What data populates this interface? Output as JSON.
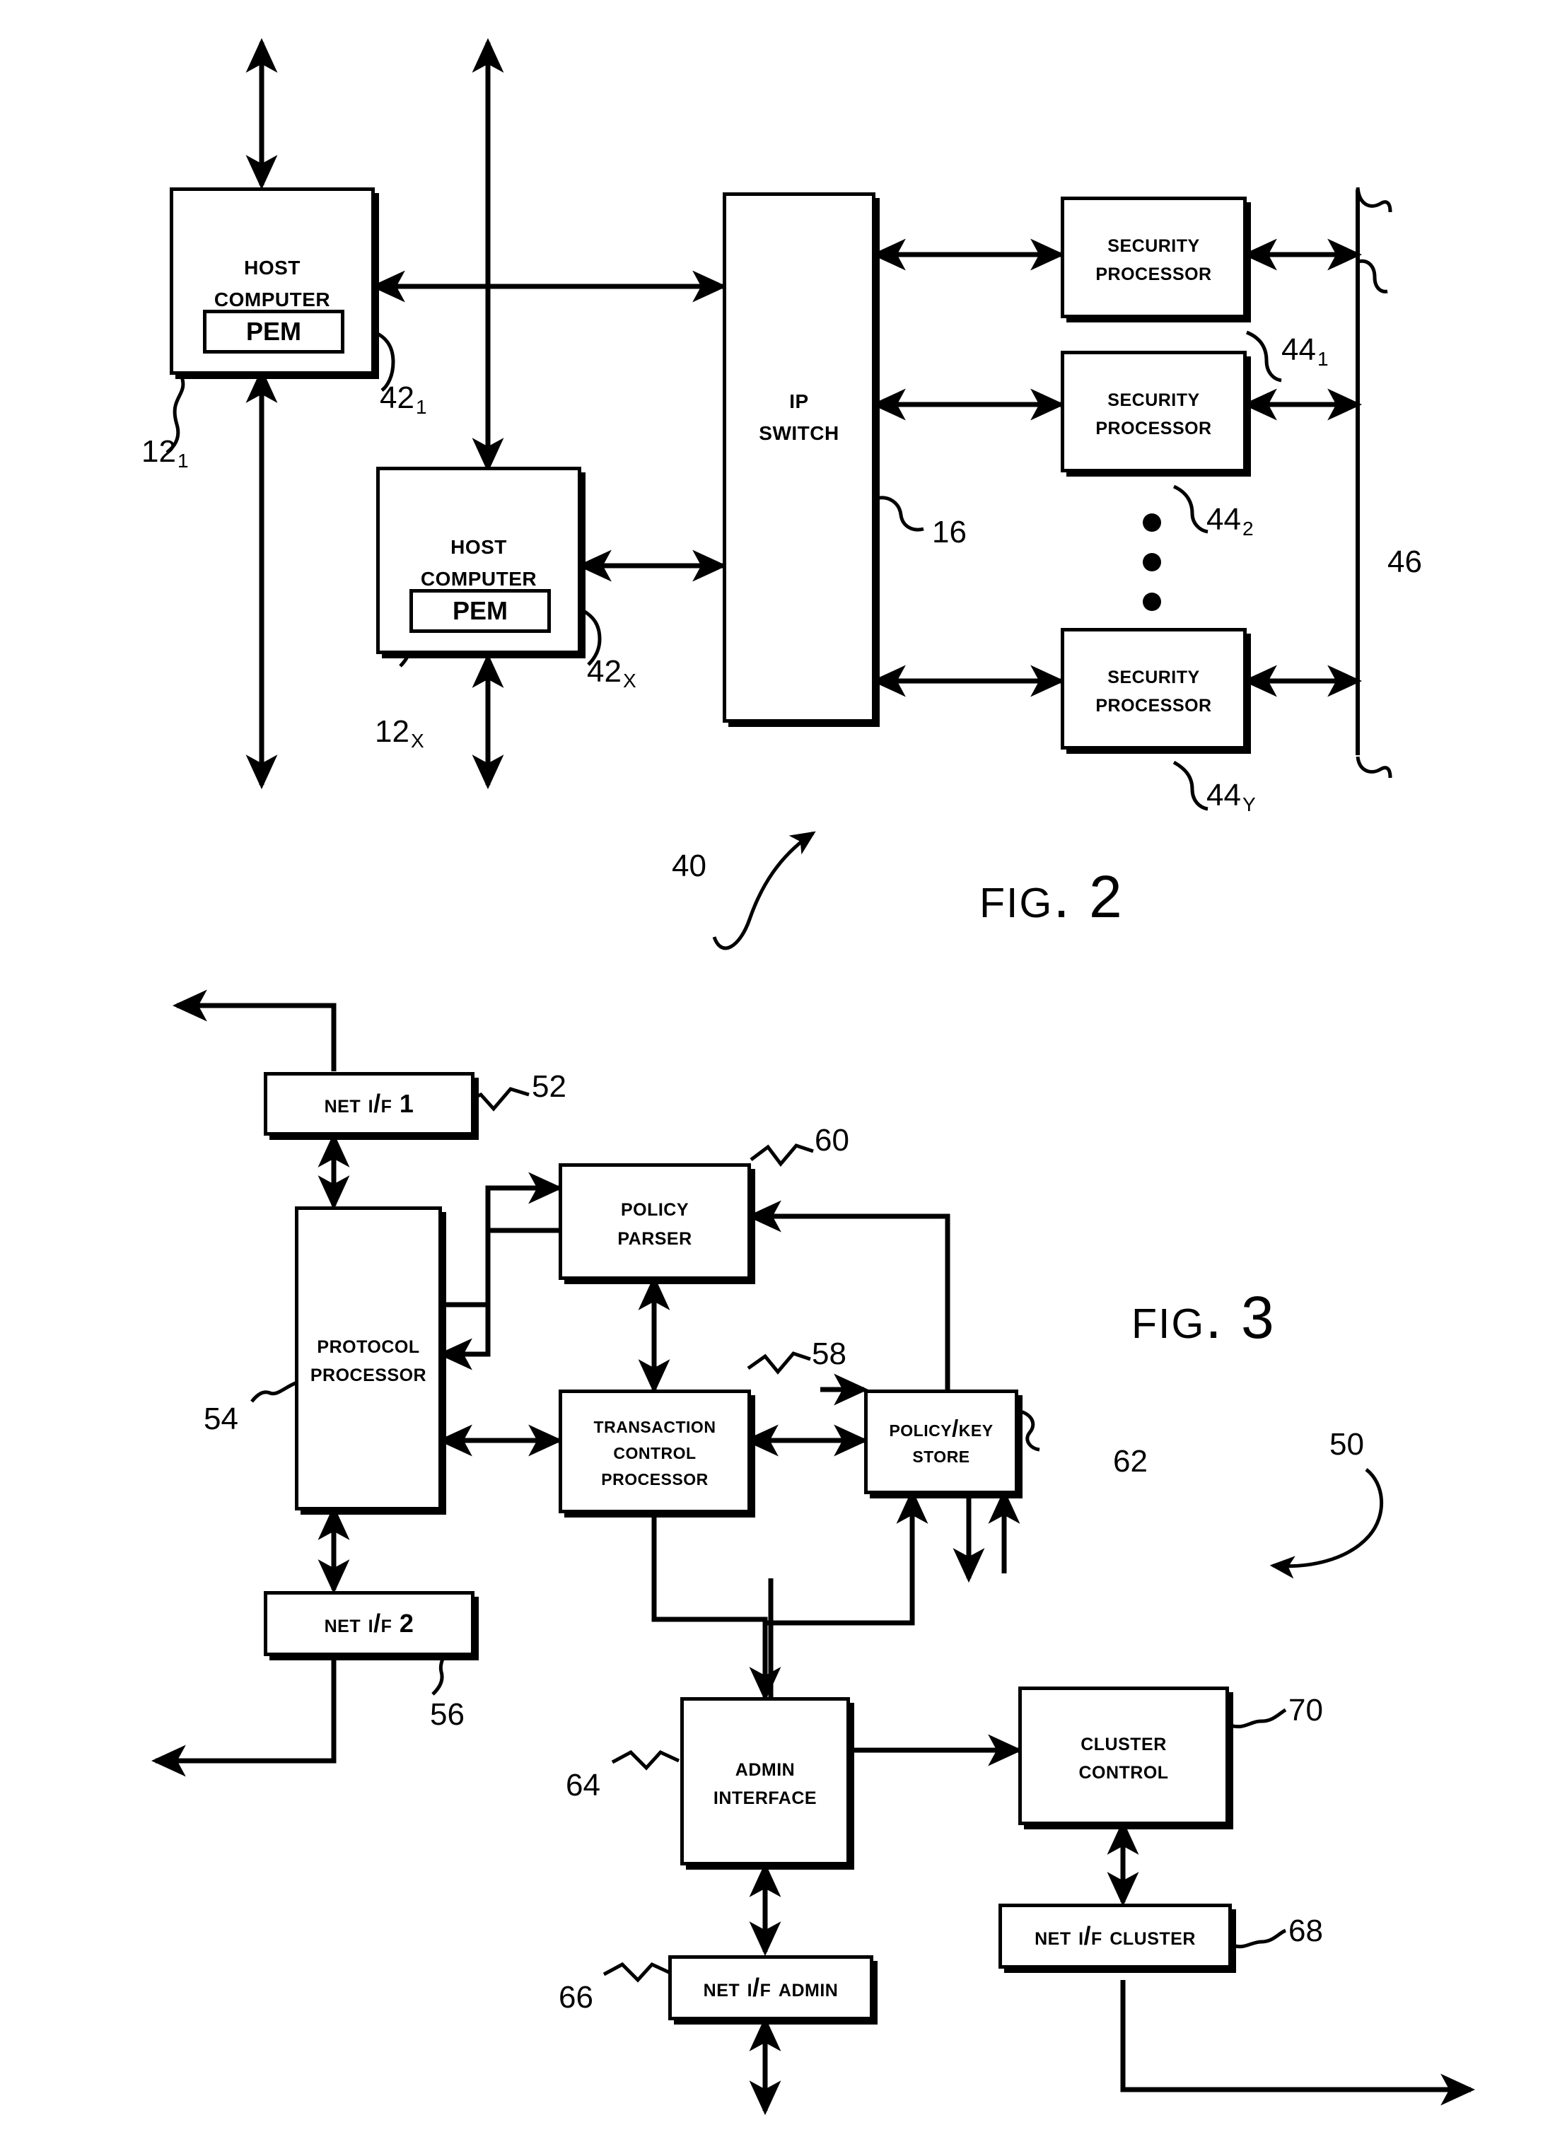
{
  "figures": [
    {
      "caption": "Fig. 2",
      "system_ref": "40"
    },
    {
      "caption": "Fig. 3",
      "system_ref": "50"
    }
  ],
  "fig2": {
    "caption": "Fig. 2",
    "system_ref": "40",
    "blocks": {
      "host1": {
        "line1": "Host",
        "line2": "Computer",
        "inner": "PEM"
      },
      "host2": {
        "line1": "Host",
        "line2": "Computer",
        "inner": "PEM"
      },
      "switch": {
        "line1": "IP",
        "line2": "Switch"
      },
      "sp1": {
        "line1": "Security",
        "line2": "Processor"
      },
      "sp2": {
        "line1": "Security",
        "line2": "Processor"
      },
      "spY": {
        "line1": "Security",
        "line2": "Processor"
      }
    },
    "refs": {
      "host1": "12",
      "host1_sub": "1",
      "host2": "12",
      "host2_sub": "X",
      "pem1": "42",
      "pem1_sub": "1",
      "pem2": "42",
      "pem2_sub": "X",
      "switch": "16",
      "sp1": "44",
      "sp1_sub": "1",
      "sp2": "44",
      "sp2_sub": "2",
      "spY": "44",
      "spY_sub": "Y",
      "bus": "46"
    }
  },
  "fig3": {
    "caption": "Fig. 3",
    "system_ref": "50",
    "blocks": {
      "netif1": {
        "label": "Net I/F 1"
      },
      "protocol": {
        "line1": "Protocol",
        "line2": "Processor"
      },
      "netif2": {
        "label": "Net I/F 2"
      },
      "policy_parser": {
        "line1": "Policy",
        "line2": "Parser"
      },
      "transaction": {
        "line1": "Transaction",
        "line2": "Control",
        "line3": "Processor"
      },
      "policy_key_store": {
        "line1": "Policy/Key",
        "line2": "Store"
      },
      "admin": {
        "line1": "Admin",
        "line2": "Interface"
      },
      "netif_admin": {
        "label": "Net I/F Admin"
      },
      "cluster": {
        "line1": "Cluster",
        "line2": "Control"
      },
      "netif_cluster": {
        "label": "Net I/F Cluster"
      }
    },
    "refs": {
      "netif1": "52",
      "protocol": "54",
      "netif2": "56",
      "policy_parser": "60",
      "transaction": "58",
      "policy_key_store": "62",
      "admin": "64",
      "netif_admin": "66",
      "netif_cluster": "68",
      "cluster": "70"
    }
  }
}
